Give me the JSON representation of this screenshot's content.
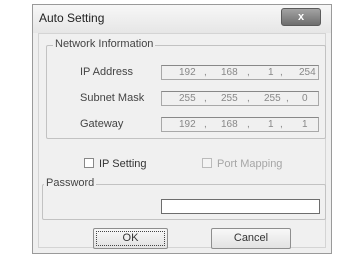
{
  "window": {
    "title": "Auto Setting",
    "close_symbol": "x"
  },
  "network": {
    "group_label": "Network Information",
    "ip_address": {
      "label": "IP Address",
      "octets": [
        "192",
        "168",
        "1",
        "254"
      ]
    },
    "subnet_mask": {
      "label": "Subnet Mask",
      "octets": [
        "255",
        "255",
        "255",
        "0"
      ]
    },
    "gateway": {
      "label": "Gateway",
      "octets": [
        "192",
        "168",
        "1",
        "1"
      ]
    },
    "separator": ","
  },
  "options": {
    "ip_setting": {
      "label": "IP Setting",
      "checked": false,
      "enabled": true
    },
    "port_mapping": {
      "label": "Port Mapping",
      "checked": false,
      "enabled": false
    }
  },
  "password": {
    "group_label": "Password",
    "value": ""
  },
  "buttons": {
    "ok": "OK",
    "cancel": "Cancel"
  }
}
